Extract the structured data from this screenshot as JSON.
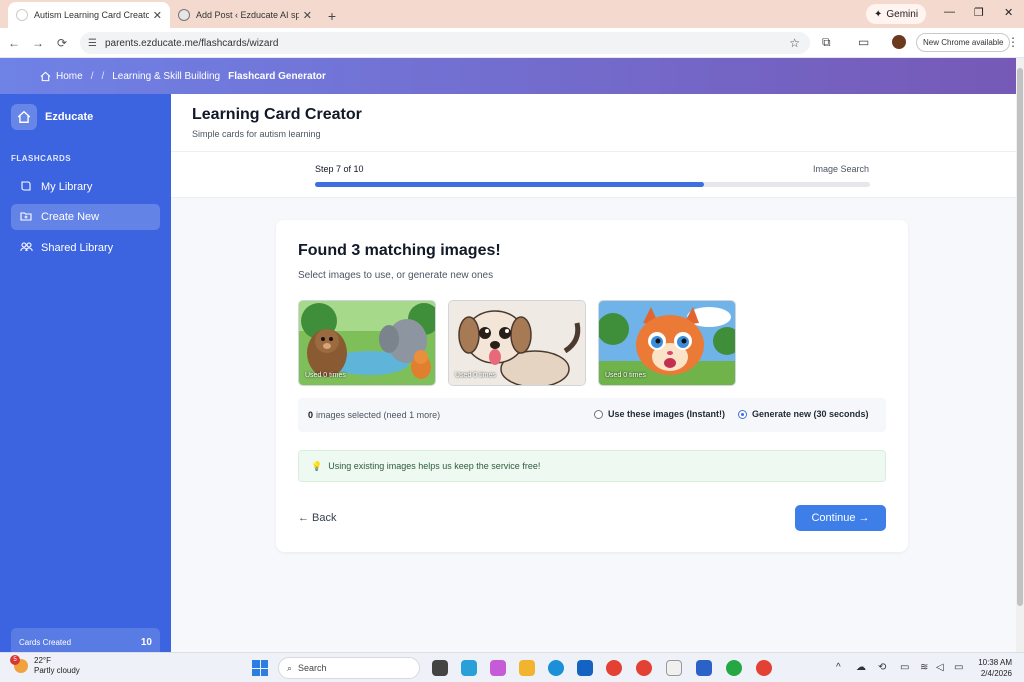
{
  "browser": {
    "tabs": [
      {
        "title": "Autism Learning Card Creator",
        "active": true
      },
      {
        "title": "Add Post ‹ Ezducate AI special",
        "active": false
      }
    ],
    "url": "parents.ezducate.me/flashcards/wizard",
    "gemini_label": "Gemini",
    "update_label": "New Chrome available"
  },
  "breadcrumb": {
    "home": "Home",
    "sep": "/",
    "level1": "Learning & Skill Building",
    "current": "Flashcard Generator"
  },
  "sidebar": {
    "brand": "Ezducate",
    "section": "FLASHCARDS",
    "items": [
      {
        "label": "My Library",
        "icon": "book-icon"
      },
      {
        "label": "Create New",
        "icon": "add-folder-icon"
      },
      {
        "label": "Shared Library",
        "icon": "people-icon"
      }
    ],
    "stat_label": "Cards Created",
    "stat_value": "10"
  },
  "page": {
    "title": "Learning Card Creator",
    "subtitle": "Simple cards for autism learning",
    "step_text": "Step 7 of 10",
    "step_label": "Image Search",
    "progress_fraction": 0.7
  },
  "results": {
    "heading": "Found 3 matching images!",
    "subheading": "Select images to use, or generate new ones",
    "images": [
      {
        "used": "Used 0 times"
      },
      {
        "used": "Used 0 times"
      },
      {
        "used": "Used 0 times"
      }
    ],
    "selected_count": "0",
    "selected_text": "images selected (need 1 more)",
    "option_use": "Use these images (Instant!)",
    "option_generate": "Generate new (30 seconds)",
    "tip": "Using existing images helps us keep the service free!",
    "back": "← Back",
    "continue": "Continue →"
  },
  "taskbar": {
    "temp": "22°F",
    "weather": "Partly cloudy",
    "weather_badge": "5",
    "search": "Search",
    "time": "10:38 AM",
    "date": "2/4/2026"
  },
  "colors": {
    "sidebar": "#3d64e0",
    "accent": "#3d7ee8",
    "header_start": "#6f82e6",
    "header_end": "#7659b7"
  }
}
